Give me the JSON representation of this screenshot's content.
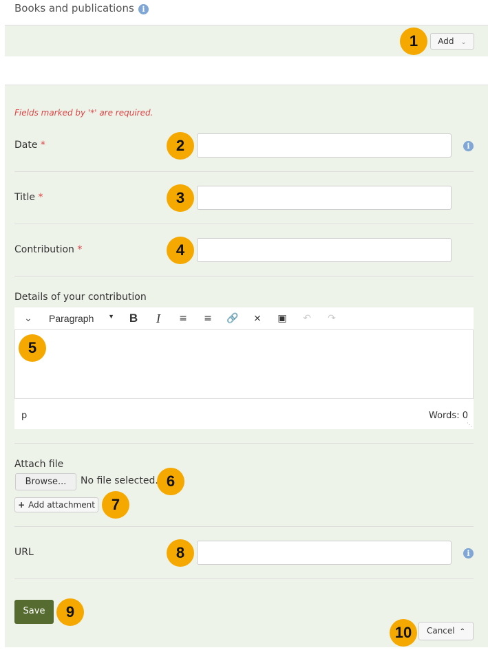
{
  "header": {
    "title": "Books and publications",
    "info_icon": "info-icon"
  },
  "topbar": {
    "add_label": "Add",
    "add_icon": "chevron-down-icon"
  },
  "form": {
    "required_note": "Fields marked by '*' are required.",
    "required_marker": "*",
    "date_label": "Date",
    "date_value": "",
    "title_label": "Title",
    "title_value": "",
    "contribution_label": "Contribution",
    "contribution_value": "",
    "details_label": "Details of your contribution",
    "editor": {
      "format_select": "Paragraph",
      "toolbar_icons": [
        "collapse-toolbar-icon",
        "bold-icon",
        "italic-icon",
        "bullet-list-icon",
        "numbered-list-icon",
        "link-icon",
        "unlink-icon",
        "image-icon",
        "undo-icon",
        "redo-icon"
      ],
      "path": "p",
      "word_count": "Words: 0"
    },
    "attach_label": "Attach file",
    "browse_label": "Browse...",
    "no_file": "No file selected.",
    "add_attachment_label": "Add attachment",
    "url_label": "URL",
    "url_value": "",
    "save_label": "Save",
    "cancel_label": "Cancel"
  },
  "callouts": [
    "1",
    "2",
    "3",
    "4",
    "5",
    "6",
    "7",
    "8",
    "9",
    "10"
  ],
  "colors": {
    "accent": "#f5a800",
    "save": "#556b2f",
    "required": "#dd4444",
    "panel": "#eef3ea",
    "info": "#7fa6d4"
  }
}
